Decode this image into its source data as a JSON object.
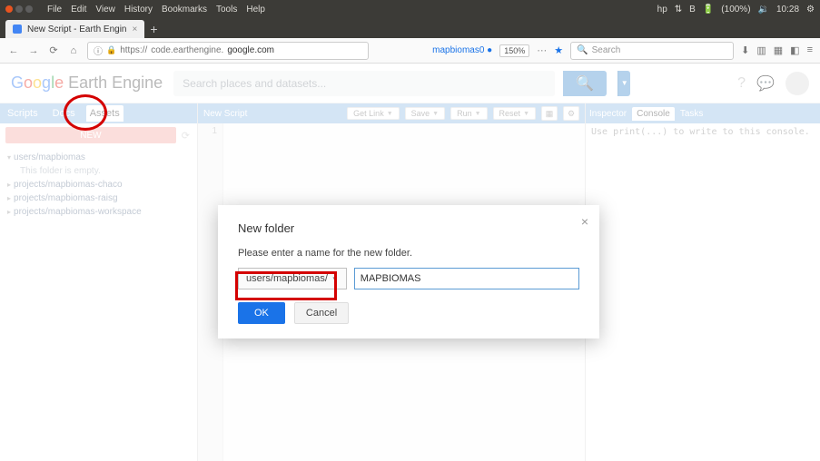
{
  "ubuntu": {
    "menus": [
      "File",
      "Edit",
      "View",
      "History",
      "Bookmarks",
      "Tools",
      "Help"
    ],
    "battery": "(100%)",
    "time": "10:28"
  },
  "browser": {
    "tab_title": "New Script - Earth Engin",
    "url_prefix": "https://",
    "url_host": "code.earthengine.",
    "url_domain": "google.com",
    "zoom_user": "mapbiomas0",
    "zoom_pct": "150%",
    "search_placeholder": "Search"
  },
  "gee": {
    "logo_rest": "Earth Engine",
    "search_placeholder": "Search places and datasets..."
  },
  "left": {
    "tabs": [
      "Scripts",
      "Docs",
      "Assets"
    ],
    "new_btn": "NEW",
    "tree": {
      "r0": "users/mapbiomas",
      "empty": "This folder is empty.",
      "r1": "projects/mapbiomas-chaco",
      "r2": "projects/mapbiomas-raisg",
      "r3": "projects/mapbiomas-workspace"
    }
  },
  "center": {
    "title": "New Script",
    "btn_getlink": "Get Link",
    "btn_save": "Save",
    "btn_run": "Run",
    "btn_reset": "Reset",
    "line1": "1"
  },
  "right": {
    "tabs": [
      "Inspector",
      "Console",
      "Tasks"
    ],
    "console_hint": "Use print(...) to write to this console."
  },
  "modal": {
    "title": "New folder",
    "prompt": "Please enter a name for the new folder.",
    "path": "users/mapbiomas/",
    "input_value": "MAPBIOMAS",
    "ok": "OK",
    "cancel": "Cancel"
  }
}
